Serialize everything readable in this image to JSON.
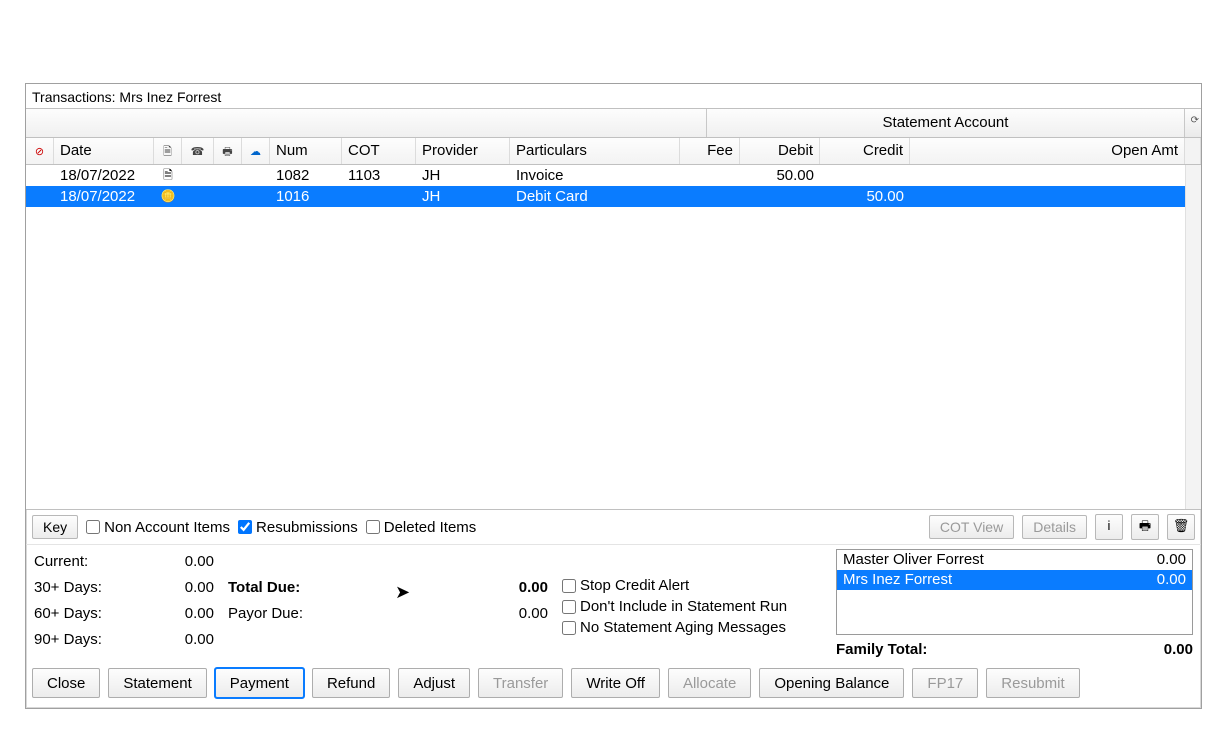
{
  "window": {
    "title": "Transactions: Mrs Inez Forrest"
  },
  "account_strip": {
    "label": "Statement Account"
  },
  "columns": {
    "alert": "⊘",
    "date": "Date",
    "doc_icon": "🗎",
    "phone_icon": "☎",
    "print_icon": "🖶",
    "cloud_icon": "☁",
    "num": "Num",
    "cot": "COT",
    "provider": "Provider",
    "particulars": "Particulars",
    "fee": "Fee",
    "debit": "Debit",
    "credit": "Credit",
    "open_amt": "Open Amt"
  },
  "rows": [
    {
      "date": "18/07/2022",
      "icon": "🗎",
      "num": "1082",
      "cot": "1103",
      "provider": "JH",
      "particulars": "Invoice",
      "fee": "",
      "debit": "50.00",
      "credit": "",
      "open": "",
      "selected": false
    },
    {
      "date": "18/07/2022",
      "icon": "🪙",
      "num": "1016",
      "cot": "",
      "provider": "JH",
      "particulars": "Debit Card",
      "fee": "",
      "debit": "",
      "credit": "50.00",
      "open": "",
      "selected": true
    }
  ],
  "filters": {
    "key_btn": "Key",
    "non_account_items": {
      "label": "Non Account Items",
      "checked": false
    },
    "resubmissions": {
      "label": "Resubmissions",
      "checked": true
    },
    "deleted_items": {
      "label": "Deleted Items",
      "checked": false
    },
    "cot_view": "COT View",
    "details": "Details",
    "info_icon": "i",
    "print_icon": "🖶",
    "trash_icon": "🗑"
  },
  "aging": {
    "current": {
      "label": "Current:",
      "value": "0.00"
    },
    "d30": {
      "label": "30+ Days:",
      "value": "0.00"
    },
    "d60": {
      "label": "60+ Days:",
      "value": "0.00"
    },
    "d90": {
      "label": "90+ Days:",
      "value": "0.00"
    }
  },
  "totals": {
    "total_due": {
      "label": "Total Due:",
      "value": "0.00"
    },
    "payor_due": {
      "label": "Payor Due:",
      "value": "0.00"
    }
  },
  "options": {
    "stop_credit": {
      "label": "Stop Credit Alert",
      "checked": false
    },
    "no_stmt_run": {
      "label": "Don't Include in Statement Run",
      "checked": false
    },
    "no_aging": {
      "label": "No Statement Aging Messages",
      "checked": false
    }
  },
  "family": {
    "members": [
      {
        "name": "Master Oliver Forrest",
        "amount": "0.00",
        "selected": false
      },
      {
        "name": "Mrs Inez Forrest",
        "amount": "0.00",
        "selected": true
      }
    ],
    "total_label": "Family Total:",
    "total_value": "0.00"
  },
  "buttons": {
    "close": "Close",
    "statement": "Statement",
    "payment": "Payment",
    "refund": "Refund",
    "adjust": "Adjust",
    "transfer": "Transfer",
    "writeoff": "Write Off",
    "allocate": "Allocate",
    "opening": "Opening Balance",
    "fp17": "FP17",
    "resubmit": "Resubmit"
  }
}
